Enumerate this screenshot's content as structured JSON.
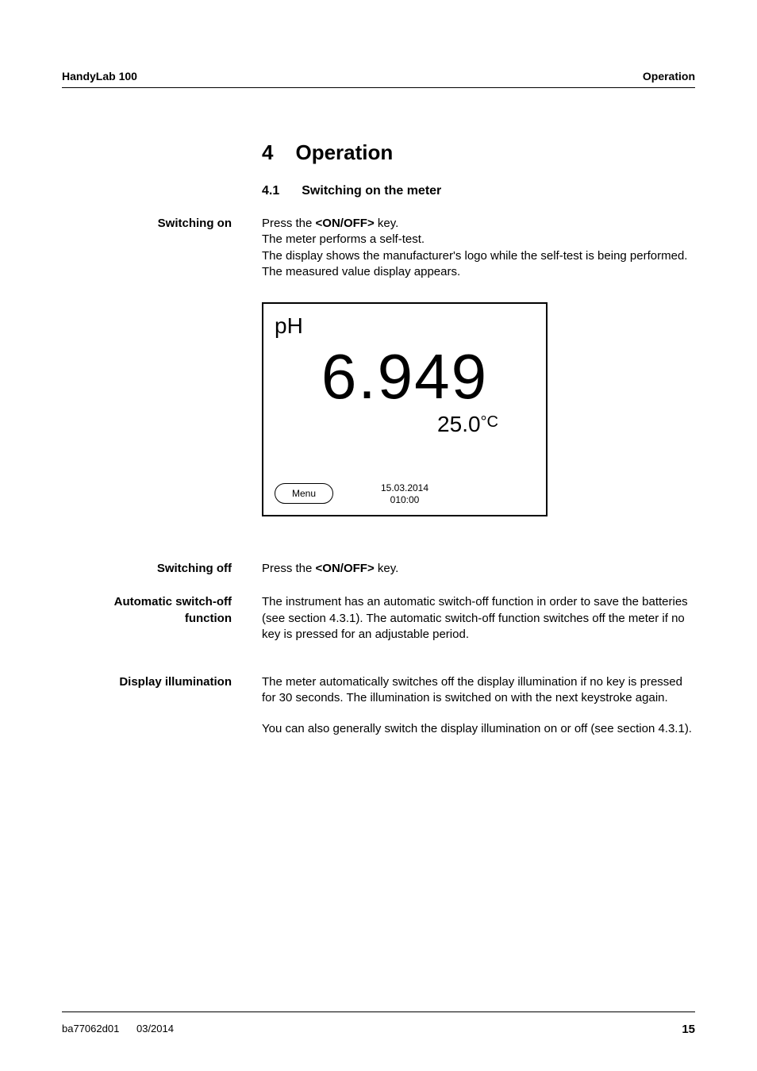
{
  "header": {
    "left": "HandyLab 100",
    "right": "Operation"
  },
  "chapter": {
    "num": "4",
    "title": "Operation"
  },
  "subsec": {
    "num": "4.1",
    "title": "Switching on the meter"
  },
  "switching_on": {
    "label": "Switching on",
    "lines": [
      "Press the <ON/OFF> key.",
      "The meter performs a self-test.",
      "The display shows the manufacturer's logo while the self-test is being performed.",
      "The measured value display appears."
    ]
  },
  "lcd": {
    "ph_label": "pH",
    "value": "6.949",
    "temp": "25.0",
    "temp_unit": "°C",
    "menu": "Menu",
    "date": "15.03.2014",
    "time": "010:00"
  },
  "switching_off": {
    "label": "Switching off",
    "text": "Press the <ON/OFF> key."
  },
  "auto_off": {
    "label_l1": "Automatic switch-off",
    "label_l2": "function",
    "text": "The instrument has an automatic switch-off function in order to save the batteries (see section 4.3.1). The automatic switch-off function switches off the meter if no key is pressed for an adjustable period."
  },
  "illum": {
    "label": "Display illumination",
    "p1": "The meter automatically switches off the display illumination if no key is pressed for 30 seconds. The illumination is switched on with the next keystroke again.",
    "p2": "You can also generally switch the display illumination on or off (see section 4.3.1)."
  },
  "footer": {
    "doc": "ba77062d01",
    "date": "03/2014",
    "page": "15"
  }
}
